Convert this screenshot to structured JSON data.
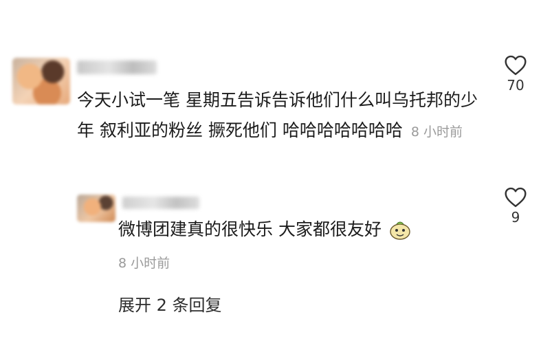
{
  "comment": {
    "text": "今天小试一笔 星期五告诉告诉他们什么叫乌托邦的少年 叙利亚的粉丝 撅死他们 哈哈哈哈哈哈哈",
    "time": "8 小时前",
    "likes": "70"
  },
  "reply": {
    "text": "微博团建真的很快乐 大家都很友好",
    "time": "8 小时前",
    "likes": "9",
    "emoji_icon": "meme-face-icon"
  },
  "expand_label": "展开 2 条回复",
  "icons": {
    "like": "heart-outline-icon"
  }
}
